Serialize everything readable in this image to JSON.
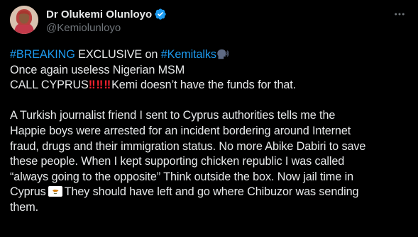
{
  "author": {
    "display_name": "Dr Olukemi Olunloyo",
    "handle": "@Kemiolunloyo",
    "verified": true
  },
  "icons": {
    "verified": "verified-badge-icon",
    "more": "more-options-icon",
    "speaking_head": "speaking-head-emoji",
    "double_exclamation": "double-exclamation-emoji",
    "flag": "cyprus-flag-emoji"
  },
  "colors": {
    "background": "#000000",
    "text": "#e7e9ea",
    "muted": "#71767b",
    "link": "#1d9bf0",
    "verified": "#1d9bf0",
    "exclamation": "#f4212e"
  },
  "tweet": {
    "line1": {
      "hashtag_breaking": "#BREAKING",
      "text_exclusive": " EXCLUSIVE on ",
      "hashtag_kemitalks": "#Kemitalks"
    },
    "line2": "Once again useless Nigerian MSM",
    "line3": {
      "text_before": "CALL CYPRUS",
      "bang_1": "‼",
      "bang_2": "‼",
      "bang_3": "‼",
      "text_after": "Kemi doesn’t have the funds for that."
    },
    "para2": {
      "l1": "A Turkish journalist friend I sent to Cyprus authorities tells me the",
      "l2": "Happie boys were arrested for an incident bordering around Internet",
      "l3": "fraud, drugs and their immigration status. No more Abike Dabiri to save",
      "l4": "these people. When I kept supporting chicken republic I was called",
      "l5": "“always going to the opposite” Think outside the box. Now jail time in",
      "l6_before": "Cyprus",
      "l6_after": "They should have left and go where Chibuzor was sending",
      "l7": "them."
    }
  }
}
